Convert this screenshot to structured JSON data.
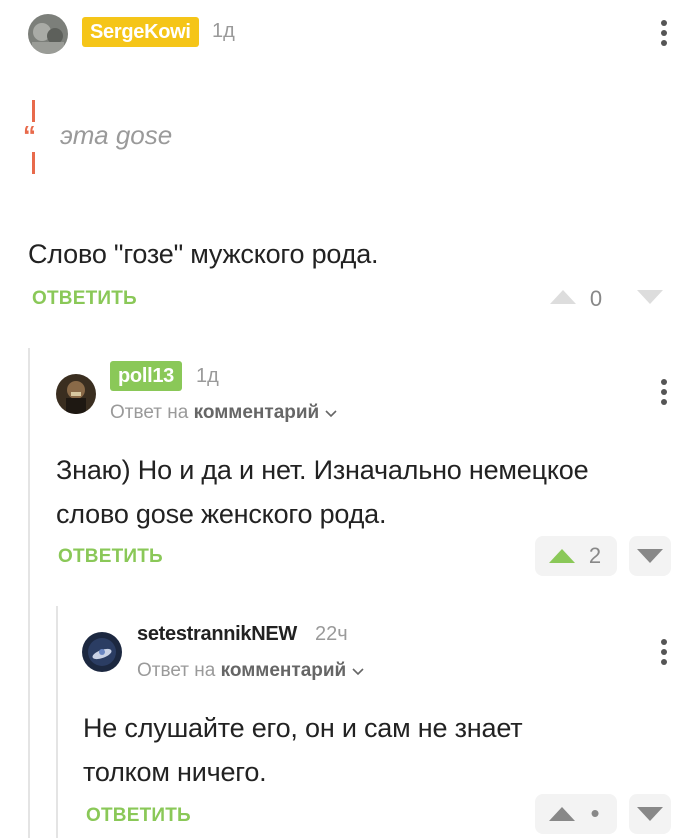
{
  "colors": {
    "accent_green": "#8ac858",
    "badge_yellow": "#f5c518",
    "quote_red": "#e86a4b",
    "muted": "#9a9a9a"
  },
  "comments": [
    {
      "username": "SergeKowi",
      "time": "1д",
      "quote": "эта gose",
      "body": "Слово \"гозе\" мужского рода.",
      "reply_label": "ОТВЕТИТЬ",
      "rating": "0",
      "upvoted": false
    },
    {
      "username": "poll13",
      "time": "1д",
      "reply_to_prefix": "Ответ на",
      "reply_to_link": "комментарий",
      "body_line1": "Знаю) Но и да и нет. Изначально немецкое",
      "body_line2": "слово gose женского рода.",
      "reply_label": "ОТВЕТИТЬ",
      "rating": "2",
      "upvoted": true
    },
    {
      "username": "setestrannikNEW",
      "time": "22ч",
      "reply_to_prefix": "Ответ на",
      "reply_to_link": "комментарий",
      "body_line1": "Не слушайте его, он и сам не знает",
      "body_line2": "толком ничего.",
      "reply_label": "ОТВЕТИТЬ",
      "rating": "•",
      "upvoted": false
    }
  ]
}
